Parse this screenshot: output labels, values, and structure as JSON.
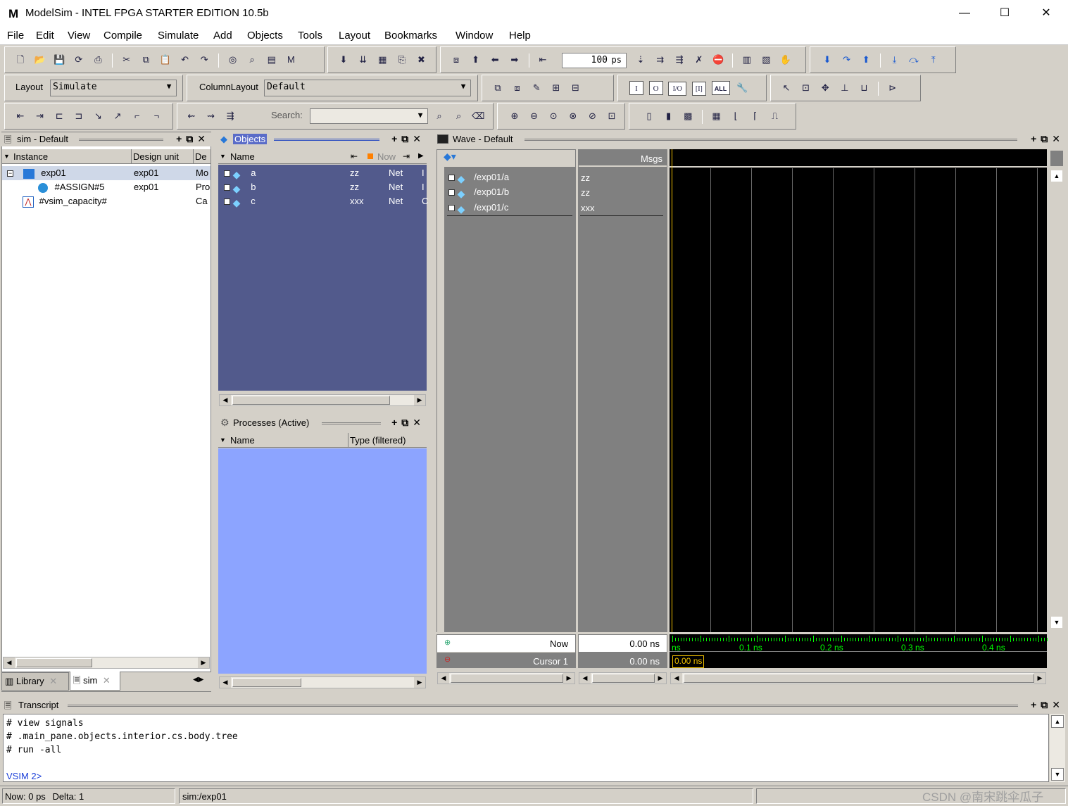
{
  "window": {
    "title": "ModelSim - INTEL FPGA STARTER EDITION 10.5b",
    "logo": "M",
    "controls": {
      "minimize": "—",
      "maximize": "☐",
      "close": "✕"
    }
  },
  "menu": [
    "File",
    "Edit",
    "View",
    "Compile",
    "Simulate",
    "Add",
    "Objects",
    "Tools",
    "Layout",
    "Bookmarks",
    "Window",
    "Help"
  ],
  "toolbar": {
    "run_length_value": "100",
    "run_length_unit": "ps",
    "layout_label": "Layout",
    "layout_value": "Simulate",
    "column_layout_label": "ColumnLayout",
    "column_layout_value": "Default",
    "search_label": "Search:",
    "search_value": "",
    "edge_buttons": [
      "I",
      "O",
      "I/O",
      "[I]",
      "ALL"
    ]
  },
  "sim_pane": {
    "title": "sim - Default",
    "columns": [
      "Instance",
      "Design unit",
      "De"
    ],
    "rows": [
      {
        "instance": "exp01",
        "design_unit": "exp01",
        "type": "Mo"
      },
      {
        "instance": "#ASSIGN#5",
        "design_unit": "exp01",
        "type": "Pro"
      },
      {
        "instance": "#vsim_capacity#",
        "design_unit": "",
        "type": "Ca"
      }
    ]
  },
  "bottom_tabs": [
    "Library",
    "sim"
  ],
  "objects_pane": {
    "title": "Objects",
    "columns": {
      "name": "Name",
      "now": "Now"
    },
    "rows": [
      {
        "name": "a",
        "value": "zz",
        "kind": "Net",
        "extra": "I"
      },
      {
        "name": "b",
        "value": "zz",
        "kind": "Net",
        "extra": "I"
      },
      {
        "name": "c",
        "value": "xxx",
        "kind": "Net",
        "extra": "C"
      }
    ]
  },
  "processes_pane": {
    "title": "Processes (Active)",
    "columns": [
      "Name",
      "Type (filtered)"
    ]
  },
  "wave_pane": {
    "title": "Wave - Default",
    "msgs_header": "Msgs",
    "signals": [
      {
        "name": "/exp01/a",
        "value": "zz"
      },
      {
        "name": "/exp01/b",
        "value": "zz"
      },
      {
        "name": "/exp01/c",
        "value": "xxx"
      }
    ],
    "now_label": "Now",
    "now_value": "0.00 ns",
    "cursor_label": "Cursor 1",
    "cursor_value": "0.00 ns",
    "cursor_flag": "0.00 ns",
    "time_ticks": [
      "ns",
      "0.1 ns",
      "0.2 ns",
      "0.3 ns",
      "0.4 ns"
    ]
  },
  "transcript": {
    "title": "Transcript",
    "lines": [
      "# view signals",
      "# .main_pane.objects.interior.cs.body.tree",
      "# run -all"
    ],
    "prompt": "VSIM 2>"
  },
  "status": {
    "now": "Now: 0 ps",
    "delta": "Delta: 1",
    "context": "sim:/exp01",
    "watermark": "CSDN @南宋跳伞瓜子"
  },
  "colors": {
    "objects_bg": "#525a8c",
    "processes_bg": "#8ca4ff",
    "wave_bg": "#000000",
    "wave_names_bg": "#808080",
    "cursor": "#f0c000",
    "grid": "#6a6a6a",
    "ticks": "#00ff00"
  }
}
